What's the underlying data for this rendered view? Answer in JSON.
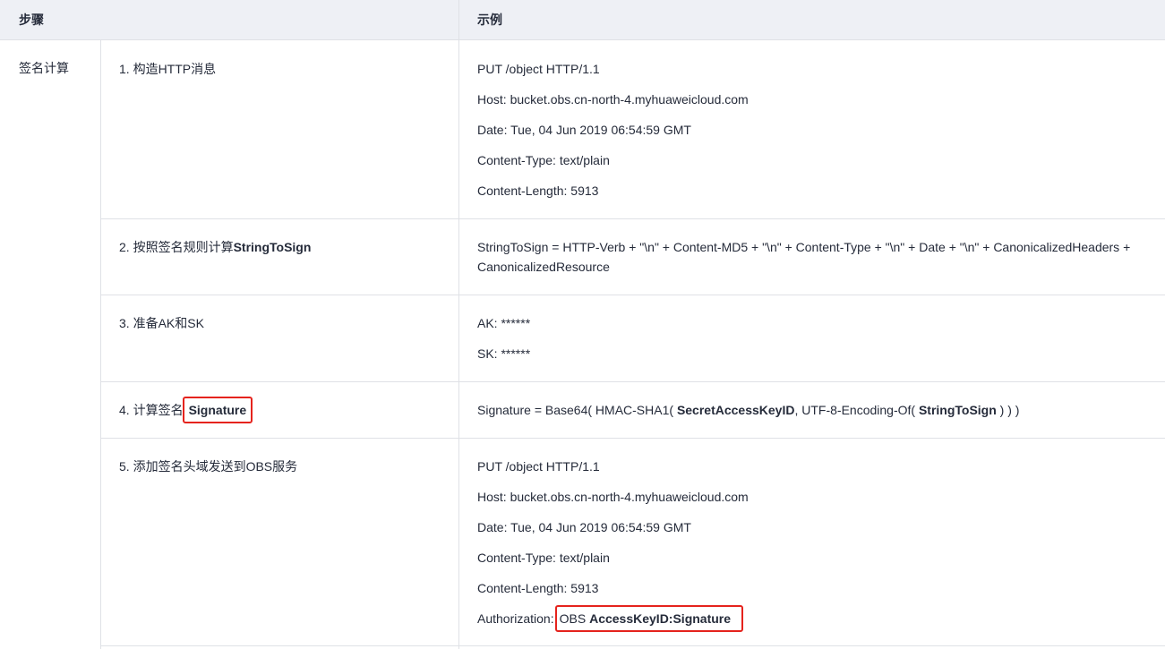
{
  "header": {
    "step": "步骤",
    "example": "示例"
  },
  "group_label": "签名计算",
  "rows": [
    {
      "step": "1. 构造HTTP消息",
      "example": [
        "PUT /object HTTP/1.1",
        "Host: bucket.obs.cn-north-4.myhuaweicloud.com",
        "Date: Tue, 04 Jun 2019 06:54:59 GMT",
        "Content-Type: text/plain",
        "Content-Length: 5913"
      ]
    },
    {
      "step_prefix": "2. 按照签名规则计算",
      "step_bold": "StringToSign",
      "example_text": "StringToSign = HTTP-Verb + \"\\n\" + Content-MD5 + \"\\n\" + Content-Type + \"\\n\" + Date + \"\\n\" + CanonicalizedHeaders + CanonicalizedResource"
    },
    {
      "step": "3. 准备AK和SK",
      "example": [
        "AK: ******",
        "SK: ******"
      ]
    },
    {
      "step_prefix": "4. 计算签名",
      "step_bold": "Signature",
      "example_parts": {
        "p1": "Signature = Base64( HMAC-SHA1( ",
        "b1": "SecretAccessKeyID",
        "p2": ", UTF-8-Encoding-Of( ",
        "b2": "StringToSign",
        "p3": " ) ) )"
      }
    },
    {
      "step": "5. 添加签名头域发送到OBS服务",
      "example": [
        "PUT /object HTTP/1.1",
        "Host: bucket.obs.cn-north-4.myhuaweicloud.com",
        "Date: Tue, 04 Jun 2019 06:54:59 GMT",
        "Content-Type: text/plain",
        "Content-Length: 5913"
      ],
      "auth_label": "Authorization:",
      "auth_plain": "OBS ",
      "auth_bold": "AccessKeyID:Signature"
    }
  ],
  "colors": {
    "header_bg": "#eef0f5",
    "border": "#dfe1e6",
    "highlight": "#e5231d",
    "text": "#252b3a"
  }
}
